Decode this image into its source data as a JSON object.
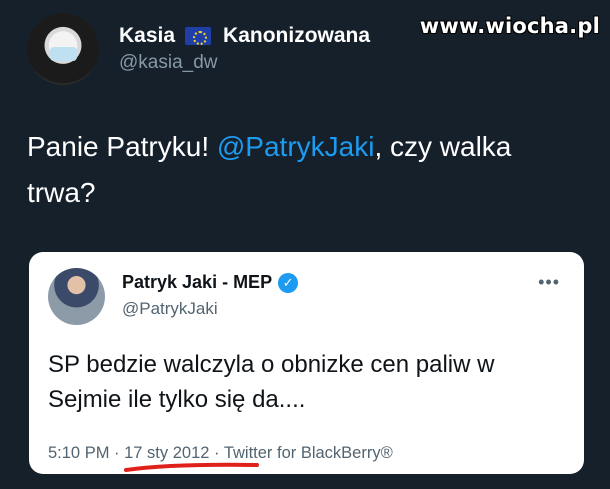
{
  "watermark": "www.wiocha.pl",
  "author": {
    "first_name": "Kasia",
    "flag_icon": "eu-flag-icon",
    "last_name": "Kanonizowana",
    "handle": "@kasia_dw"
  },
  "tweet": {
    "text_before": "Panie Patryku! ",
    "mention": "@PatrykJaki",
    "text_after": ", czy walka trwa?"
  },
  "quoted": {
    "name": "Patryk Jaki - MEP",
    "handle": "@PatrykJaki",
    "more_label": "•••",
    "text": "SP bedzie walczyla o obnizke cen paliw w Sejmie ile tylko się da....",
    "time": "5:10 PM",
    "separator": " · ",
    "date": "17 sty 2012",
    "source": "Twitter for BlackBerry®"
  },
  "colors": {
    "background": "#15202b",
    "mention": "#1d9bf0",
    "annotation_underline": "#e0201b"
  }
}
